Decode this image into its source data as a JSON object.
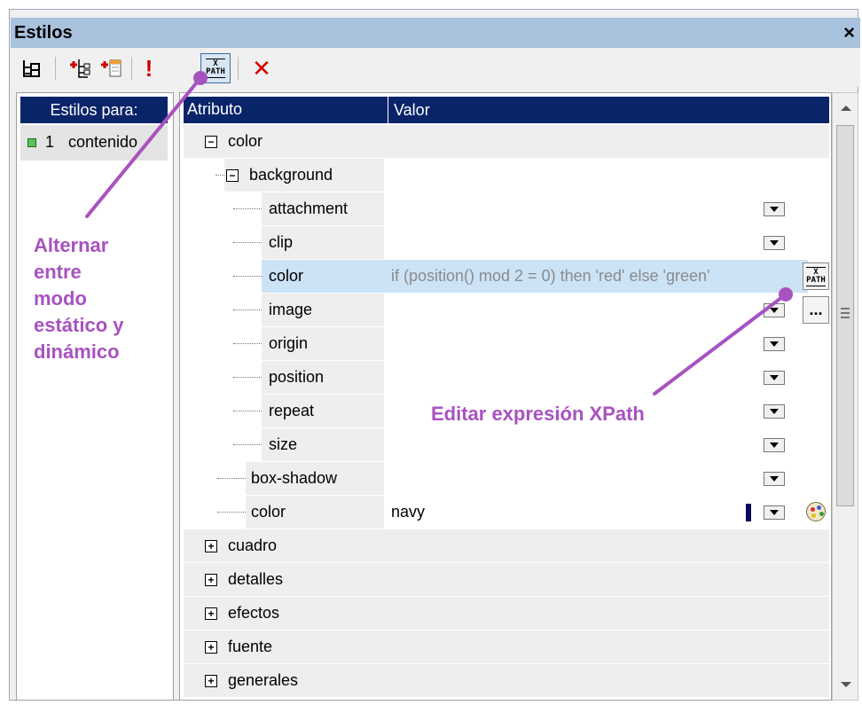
{
  "window": {
    "title": "Estilos",
    "close_label": "×"
  },
  "toolbar": {
    "xpath_label_top": "X",
    "xpath_label_bottom": "PATH",
    "important_label": "!",
    "delete_label": "✕"
  },
  "left_panel": {
    "header": "Estilos para:",
    "items": [
      {
        "num": "1",
        "label": "contenido"
      }
    ]
  },
  "grid": {
    "col_attr": "Atributo",
    "col_value": "Valor",
    "rows": [
      {
        "label": "color",
        "expander": "−"
      },
      {
        "label": "background",
        "expander": "−"
      },
      {
        "label": "attachment"
      },
      {
        "label": "clip"
      },
      {
        "label": "color",
        "value": "if (position() mod 2 = 0) then 'red' else 'green'"
      },
      {
        "label": "image"
      },
      {
        "label": "origin"
      },
      {
        "label": "position"
      },
      {
        "label": "repeat"
      },
      {
        "label": "size"
      },
      {
        "label": "box-shadow"
      },
      {
        "label": "color",
        "value": "navy"
      },
      {
        "label": "cuadro",
        "expander": "+"
      },
      {
        "label": "detalles",
        "expander": "+"
      },
      {
        "label": "efectos",
        "expander": "+"
      },
      {
        "label": "fuente",
        "expander": "+"
      },
      {
        "label": "generales",
        "expander": "+"
      }
    ],
    "more_button": "...",
    "swatch_color": "#0a0a5a"
  },
  "annotations": {
    "left": [
      "Alternar",
      "entre",
      "modo",
      "estático y",
      "dinámico"
    ],
    "right": "Editar expresión XPath",
    "color": "#a852c0"
  }
}
